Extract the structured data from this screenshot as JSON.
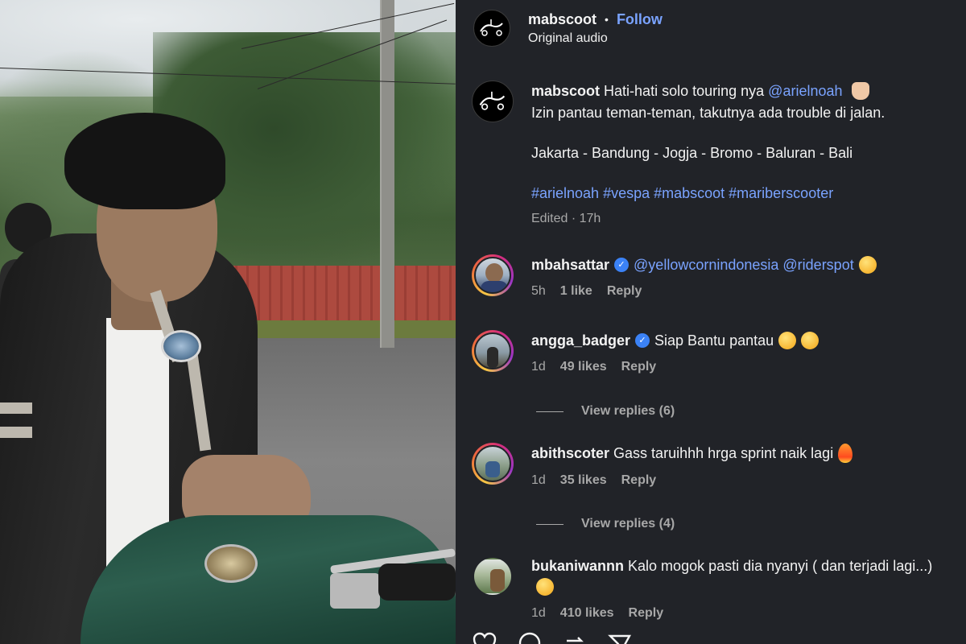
{
  "post": {
    "username": "mabscoot",
    "follow_label": "Follow",
    "dot": "•",
    "audio": "Original audio"
  },
  "caption": {
    "username": "mabscoot",
    "text_1": "Hati-hati solo touring nya",
    "mention": "@arielnoah",
    "text_2": "Izin pantau teman-teman, takutnya ada trouble di jalan.",
    "route": "Jakarta - Bandung - Jogja - Bromo - Baluran - Bali",
    "hashtags": "#arielnoah #vespa #mabscoot #mariberscooter",
    "meta": "Edited · 17h"
  },
  "comments": [
    {
      "username": "mbahsattar",
      "verified": true,
      "mentions": "@yellowcornindonesia @riderspot",
      "text": "",
      "emoji": "grinning-face-icon",
      "time": "5h",
      "likes": "1 like",
      "reply": "Reply"
    },
    {
      "username": "angga_badger",
      "verified": true,
      "text": "Siap Bantu pantau",
      "emoji": "heart-eyes-icon",
      "time": "1d",
      "likes": "49 likes",
      "reply": "Reply",
      "view_replies": "View replies (6)"
    },
    {
      "username": "abithscoter",
      "verified": false,
      "text": "Gass taruihhh hrga sprint naik lagi",
      "emoji": "fire-icon",
      "time": "1d",
      "likes": "35 likes",
      "reply": "Reply",
      "view_replies": "View replies (4)"
    },
    {
      "username": "bukaniwannn",
      "verified": false,
      "text": "Kalo mogok pasti dia nyanyi ( dan terjadi lagi...)",
      "emoji": "face-with-tears-of-joy-icon",
      "time": "1d",
      "likes": "410 likes",
      "reply": "Reply"
    }
  ],
  "colors": {
    "panel_bg": "#212328",
    "link": "#7aa3ff",
    "muted": "#a8a8a8",
    "verified": "#3b82f6"
  }
}
